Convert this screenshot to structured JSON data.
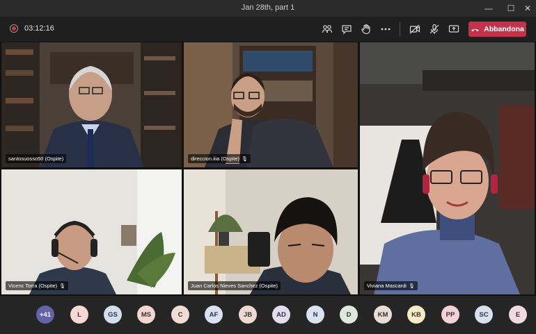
{
  "window": {
    "title": "Jan 28th, part 1",
    "minimize": "—",
    "maximize": "☐",
    "close": "✕"
  },
  "toolbar": {
    "timer": "03:12:16",
    "leave_label": "Abbandona",
    "icons": [
      "participants-icon",
      "chat-icon",
      "raise-hand-icon",
      "more-actions-icon",
      "camera-off-icon",
      "mic-off-icon",
      "share-screen-icon"
    ]
  },
  "participants": [
    {
      "name": "santosuosso50 (Ospite)",
      "muted": false
    },
    {
      "name": "direccion.iiia (Ospite)",
      "muted": true
    },
    {
      "name": "Viviana Mascardi",
      "muted": true
    },
    {
      "name": "Vicenc Torra (Ospite)",
      "muted": true
    },
    {
      "name": "Juan Carlos Nieves Sanchez (Ospite)",
      "muted": false
    }
  ],
  "mic_glyph": "🎙",
  "roster": [
    {
      "initials": "+41",
      "color": "#6264a7"
    },
    {
      "initials": "L",
      "color": "#f6d9d4"
    },
    {
      "initials": "GS",
      "color": "#d3dff1"
    },
    {
      "initials": "MS",
      "color": "#f3d6cf"
    },
    {
      "initials": "C",
      "color": "#f0dcd2"
    },
    {
      "initials": "AF",
      "color": "#d9e2f3"
    },
    {
      "initials": "JB",
      "color": "#f0d8d4"
    },
    {
      "initials": "AD",
      "color": "#e2def0"
    },
    {
      "initials": "N",
      "color": "#d9e3f3"
    },
    {
      "initials": "D",
      "color": "#dfe8dc"
    },
    {
      "initials": "KM",
      "color": "#e9ddd6"
    },
    {
      "initials": "KB",
      "color": "#f5ecc7"
    },
    {
      "initials": "PP",
      "color": "#f3d3d9"
    },
    {
      "initials": "SC",
      "color": "#d7e2f0"
    },
    {
      "initials": "E",
      "color": "#f1dbe3"
    }
  ]
}
